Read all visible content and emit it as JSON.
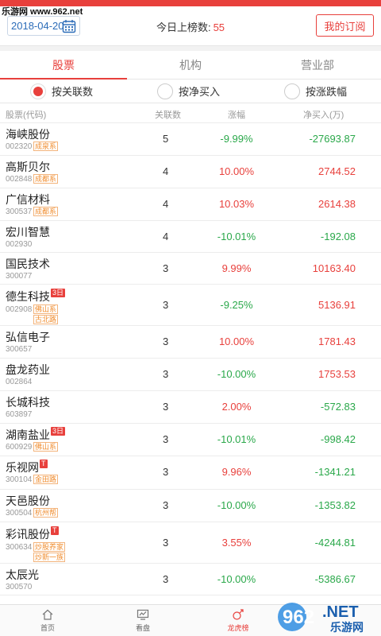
{
  "watermark": "乐游网 www.962.net",
  "header": {
    "date": "2018-04-20",
    "count_label": "今日上榜数:",
    "count_value": "55",
    "subscribe_label": "我的订阅"
  },
  "tabs": [
    {
      "label": "股票"
    },
    {
      "label": "机构"
    },
    {
      "label": "营业部"
    }
  ],
  "sorts": [
    {
      "label": "按关联数",
      "checked": true
    },
    {
      "label": "按净买入"
    },
    {
      "label": "按涨跌幅"
    }
  ],
  "columns": {
    "stock": "股票(代码)",
    "count": "关联数",
    "change": "涨幅",
    "net": "净买入(万)"
  },
  "rows": [
    {
      "name": "海峡股份",
      "code": "002320",
      "tags": [
        "成泉系"
      ],
      "count": "5",
      "change": "-9.99%",
      "net": "-27693.87"
    },
    {
      "name": "高斯贝尔",
      "code": "002848",
      "tags": [
        "成都系"
      ],
      "count": "4",
      "change": "10.00%",
      "net": "2744.52"
    },
    {
      "name": "广信材料",
      "code": "300537",
      "tags": [
        "成都系"
      ],
      "count": "4",
      "change": "10.03%",
      "net": "2614.38"
    },
    {
      "name": "宏川智慧",
      "code": "002930",
      "tags": [],
      "count": "4",
      "change": "-10.01%",
      "net": "-192.08"
    },
    {
      "name": "国民技术",
      "code": "300077",
      "tags": [],
      "count": "3",
      "change": "9.99%",
      "net": "10163.40"
    },
    {
      "name": "德生科技",
      "code": "002908",
      "badge": "3日",
      "tags": [
        "佛山系",
        "古北路"
      ],
      "count": "3",
      "change": "-9.25%",
      "net": "5136.91"
    },
    {
      "name": "弘信电子",
      "code": "300657",
      "tags": [],
      "count": "3",
      "change": "10.00%",
      "net": "1781.43"
    },
    {
      "name": "盘龙药业",
      "code": "002864",
      "tags": [],
      "count": "3",
      "change": "-10.00%",
      "net": "1753.53"
    },
    {
      "name": "长城科技",
      "code": "603897",
      "tags": [],
      "count": "3",
      "change": "2.00%",
      "net": "-572.83"
    },
    {
      "name": "湖南盐业",
      "code": "600929",
      "badge": "3日",
      "tags": [
        "佛山系"
      ],
      "count": "3",
      "change": "-10.01%",
      "net": "-998.42"
    },
    {
      "name": "乐视网",
      "code": "300104",
      "badge": "T",
      "tags": [
        "金田路"
      ],
      "count": "3",
      "change": "9.96%",
      "net": "-1341.21"
    },
    {
      "name": "天邑股份",
      "code": "300504",
      "tags": [
        "杭州帮"
      ],
      "count": "3",
      "change": "-10.00%",
      "net": "-1353.82"
    },
    {
      "name": "彩讯股份",
      "code": "300634",
      "badge": "T",
      "tags": [
        "炒股养家",
        "炒新一族"
      ],
      "count": "3",
      "change": "3.55%",
      "net": "-4244.81"
    },
    {
      "name": "太辰光",
      "code": "300570",
      "tags": [],
      "count": "3",
      "change": "-10.00%",
      "net": "-5386.67"
    }
  ],
  "nav": [
    {
      "label": "首页",
      "icon": "home-icon"
    },
    {
      "label": "看盘",
      "icon": "monitor-icon"
    },
    {
      "label": "龙虎榜",
      "icon": "dragon-tiger-icon",
      "active": true
    },
    {
      "label": "",
      "icon": "more-icon"
    }
  ],
  "brand_logo": {
    "text": "962",
    "suffix": ".NET",
    "sub": "乐游网"
  },
  "colors": {
    "accent": "#e8403c",
    "up": "#e8403c",
    "down": "#2aa84a",
    "tag": "#f08c2e"
  }
}
